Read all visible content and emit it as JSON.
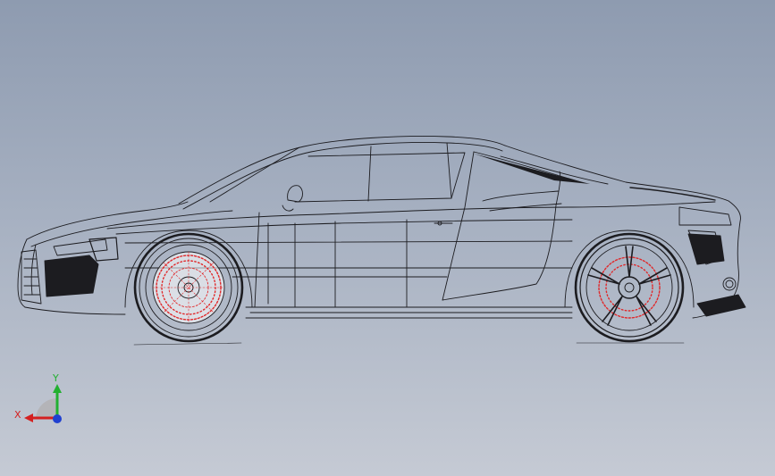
{
  "viewport": {
    "background_top": "#8e9bb0",
    "background_bottom": "#c5cad4"
  },
  "model": {
    "line_color": "#1c1c20",
    "brake_color": "#e0282a",
    "rotor_color": "#ffffff"
  },
  "triad": {
    "x_label": "X",
    "y_label": "Y",
    "x_color": "#d42020",
    "y_color": "#22b030",
    "z_color": "#2040d0"
  }
}
